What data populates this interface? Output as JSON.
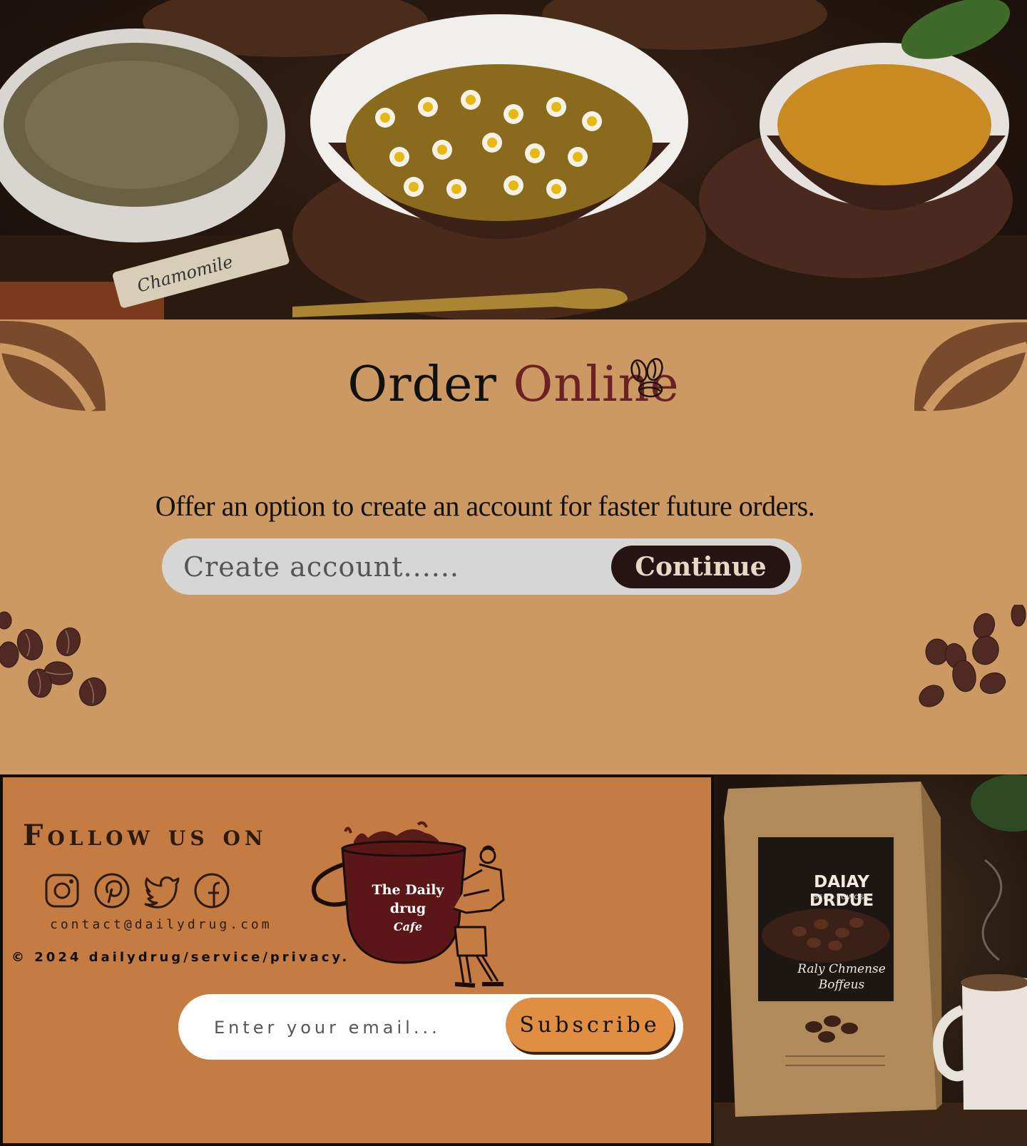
{
  "hero": {
    "image": "herbal-tea-bowls-photo",
    "tag_label": "Chamomile"
  },
  "order": {
    "title_main": "Order",
    "title_accent": "Online",
    "subtitle": "Offer an option to create an account for faster future orders.",
    "input_placeholder": "Create account......",
    "button_label": "Continue",
    "accent_color": "#6b2226",
    "background_color": "#cc9962"
  },
  "footer": {
    "follow_heading": "Follow us on",
    "socials": [
      "instagram-icon",
      "pinterest-icon",
      "twitter-icon",
      "facebook-icon"
    ],
    "contact_email": "contact@dailydrug.com",
    "copyright": "© 2024 dailydrug/service/privacy.",
    "logo_line1": "The Daily",
    "logo_line2": "drug",
    "logo_line3": "Cafe",
    "email_placeholder": "Enter your email...",
    "subscribe_label": "Subscribe",
    "background_color": "#c47c43",
    "button_color": "#e08e41"
  },
  "product": {
    "image": "coffee-bag-photo",
    "bag_brand": "DAIAY DRDUE",
    "bag_sub": "SEDT·TOWOSS",
    "bag_name_line1": "Raly Chmense",
    "bag_name_line2": "Boffeus"
  }
}
